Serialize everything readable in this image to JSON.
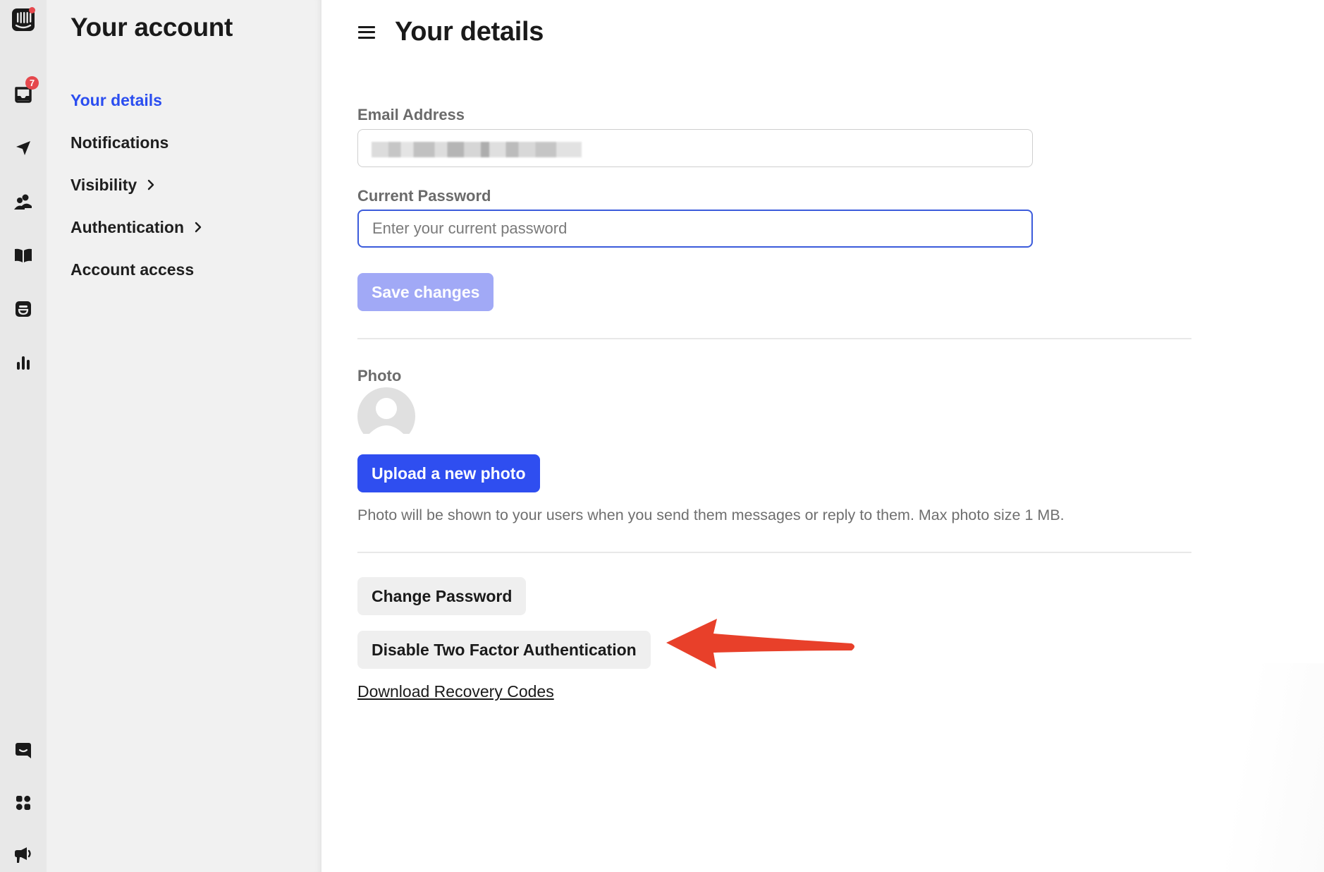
{
  "rail": {
    "icons": [
      {
        "name": "app-logo-icon",
        "badge": "dot"
      },
      {
        "name": "inbox-icon",
        "badge_count": "7"
      },
      {
        "name": "outbound-send-icon"
      },
      {
        "name": "contacts-icon"
      },
      {
        "name": "knowledge-book-icon"
      },
      {
        "name": "tickets-icon"
      },
      {
        "name": "reports-icon"
      },
      {
        "name": "messenger-icon"
      },
      {
        "name": "apps-grid-icon"
      },
      {
        "name": "announcements-icon"
      }
    ],
    "inbox_badge": "7",
    "badge_color": "#e5484d"
  },
  "sidebar": {
    "title": "Your account",
    "items": [
      {
        "label": "Your details",
        "active": true
      },
      {
        "label": "Notifications"
      },
      {
        "label": "Visibility",
        "chevron": true
      },
      {
        "label": "Authentication",
        "chevron": true
      },
      {
        "label": "Account access"
      }
    ],
    "active_color": "#2b4ef0"
  },
  "main": {
    "title": "Your details",
    "email": {
      "label": "Email Address",
      "value": "",
      "value_redacted": true
    },
    "password": {
      "label": "Current Password",
      "placeholder": "Enter your current password",
      "value": ""
    },
    "save_button": "Save changes",
    "photo": {
      "label": "Photo",
      "upload_button": "Upload a new photo",
      "help_text": "Photo will be shown to your users when you send them messages or reply to them. Max photo size 1 MB."
    },
    "change_password_button": "Change Password",
    "disable_2fa_button": "Disable Two Factor Authentication",
    "download_codes_link": "Download Recovery Codes"
  },
  "annotation": {
    "type": "arrow",
    "points_to": "Disable Two Factor Authentication",
    "color": "#e8402a"
  },
  "colors": {
    "primary": "#2f4ef0",
    "primary_disabled": "#a1a9f6",
    "focus_border": "#3b5bdb"
  }
}
